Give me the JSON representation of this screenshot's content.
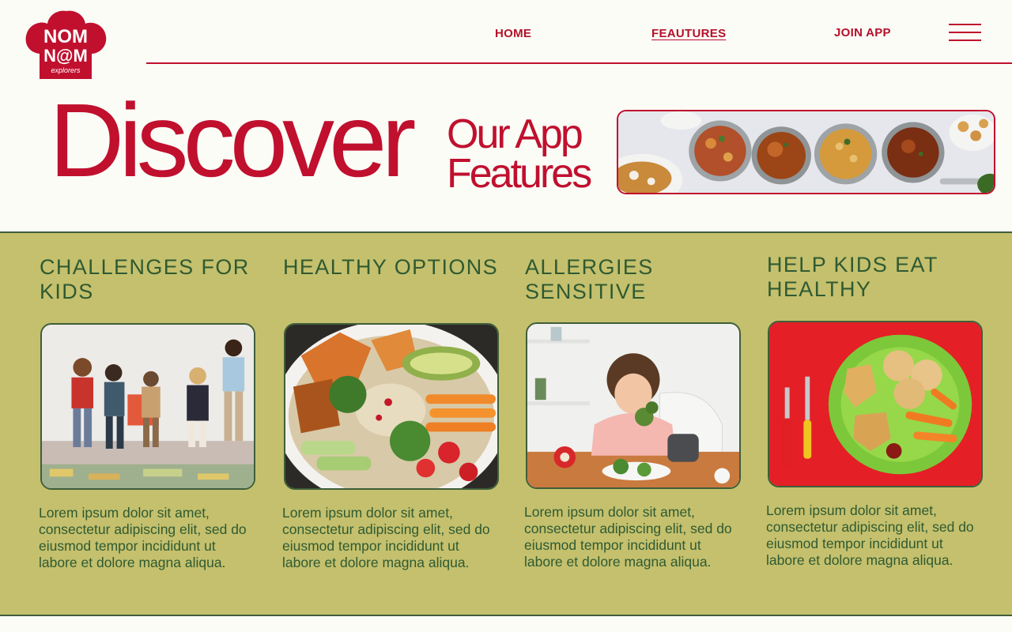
{
  "brand": {
    "logo_line1": "NOM",
    "logo_line2": "N@M",
    "logo_line3": "explorers",
    "color_primary": "#c0102e",
    "color_band": "#c4c06d",
    "color_text_green": "#2f5a32"
  },
  "nav": {
    "home": "HOME",
    "features": "FEAUTURES",
    "join": "JOIN APP",
    "menu_icon": "hamburger-menu-icon"
  },
  "hero": {
    "title": "Discover",
    "subtitle_line1": "Our App",
    "subtitle_line2": "Features"
  },
  "features": [
    {
      "title": "CHALLENGES FOR KIDS",
      "image": "children-stretching-photo",
      "text": "Lorem ipsum dolor sit amet, consectetur adipiscing elit, sed do eiusmod tempor incididunt ut labore et dolore magna aliqua."
    },
    {
      "title": "HEALTHY OPTIONS",
      "image": "salad-bowl-photo",
      "text": "Lorem ipsum dolor sit amet, consectetur adipiscing elit, sed do eiusmod tempor incididunt ut labore et dolore magna aliqua."
    },
    {
      "title": "ALLERGIES SENSITIVE",
      "image": "girl-eating-greens-photo",
      "text": "Lorem ipsum dolor sit amet, consectetur adipiscing elit, sed do eiusmod tempor incididunt ut labore et dolore magna aliqua."
    },
    {
      "title": "HELP KIDS EAT HEALTHY",
      "image": "kids-plate-photo",
      "text": "Lorem ipsum dolor sit amet, consectetur adipiscing elit, sed do eiusmod tempor incididunt ut labore et dolore magna aliqua."
    }
  ]
}
